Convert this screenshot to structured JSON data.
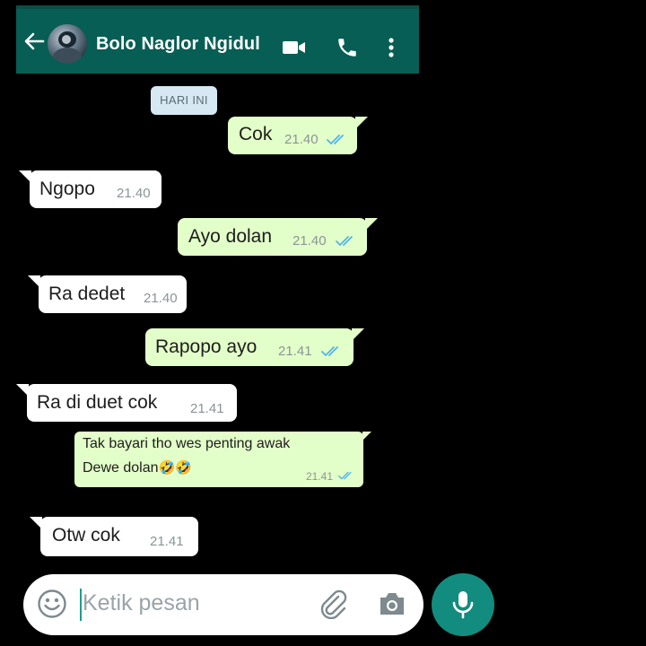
{
  "header": {
    "contact_name": "Bolo Naglor Ngidul"
  },
  "date_chip": "HARI INI",
  "messages": [
    {
      "direction": "out",
      "text": "Cok",
      "time": "21.40",
      "status": "read"
    },
    {
      "direction": "in",
      "text": "Ngopo",
      "time": "21.40"
    },
    {
      "direction": "out",
      "text": "Ayo dolan",
      "time": "21.40",
      "status": "read"
    },
    {
      "direction": "in",
      "text": "Ra dedet",
      "time": "21.40"
    },
    {
      "direction": "out",
      "text": "Rapopo ayo",
      "time": "21.41",
      "status": "read"
    },
    {
      "direction": "in",
      "text": "Ra di duet cok",
      "time": "21.41"
    },
    {
      "direction": "out",
      "line1": "Tak bayari tho wes penting awak",
      "line2": "Dewe dolan",
      "emoji": "🤣🤣",
      "time": "21.41",
      "status": "read"
    },
    {
      "direction": "in",
      "text": "Otw cok",
      "time": "21.41"
    }
  ],
  "composer": {
    "placeholder": "Ketik pesan"
  },
  "icons": {
    "back": "arrow-left",
    "video": "video-camera",
    "call": "phone",
    "menu": "vertical-dots",
    "emoji": "smiley-face",
    "attach": "paperclip",
    "camera": "camera",
    "mic": "microphone",
    "read_receipt": "double-check"
  },
  "colors": {
    "header": "#075e54",
    "outgoing_bubble": "#e3ffc9",
    "incoming_bubble": "#ffffff",
    "read_ticks": "#4fb6ec",
    "mic_button": "#128c7e",
    "date_chip": "#d6e9f3"
  }
}
